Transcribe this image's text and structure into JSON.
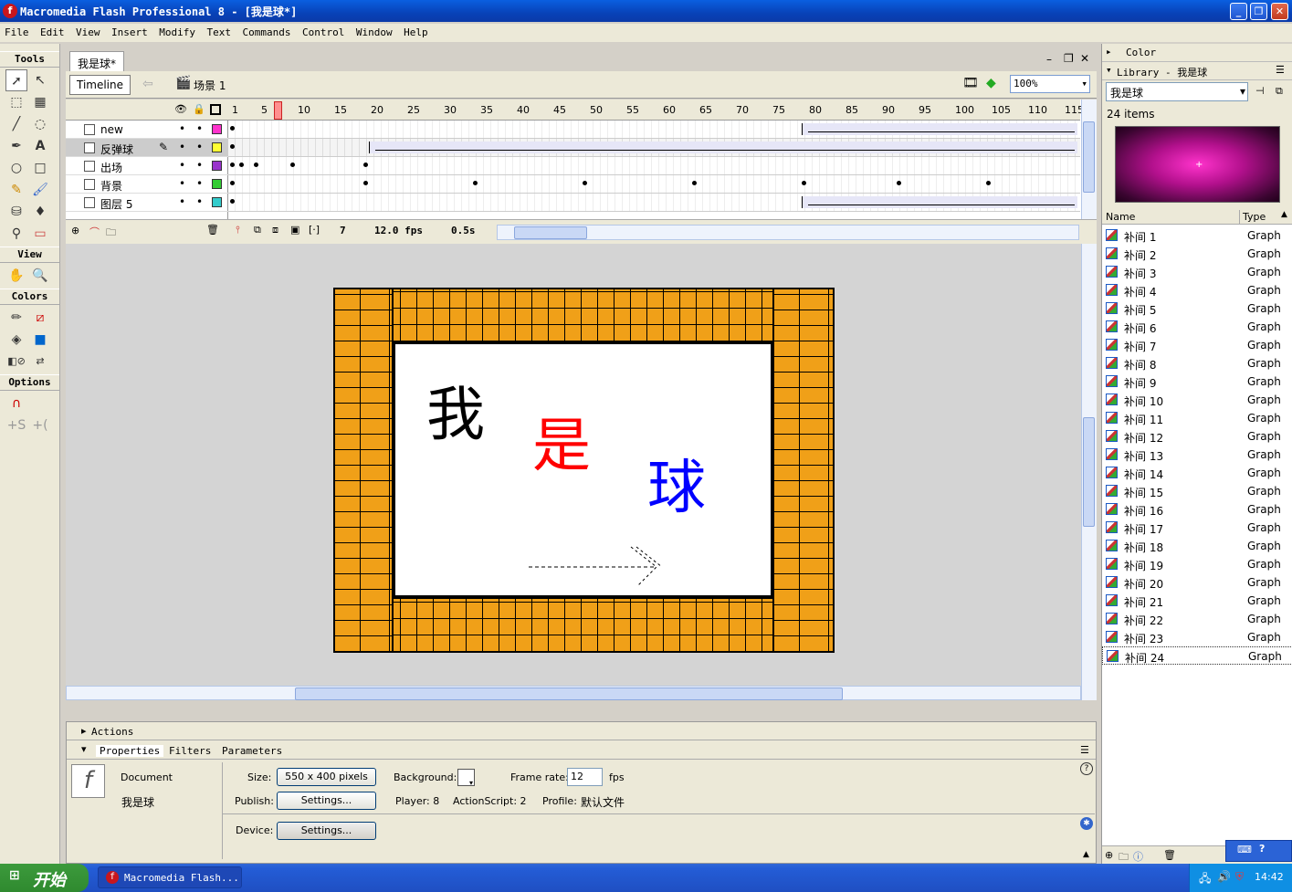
{
  "app": {
    "title": "Macromedia Flash Professional 8 - [我是球*]",
    "icon": "flash-app-icon"
  },
  "menu": [
    "File",
    "Edit",
    "View",
    "Insert",
    "Modify",
    "Text",
    "Commands",
    "Control",
    "Window",
    "Help"
  ],
  "tools": {
    "heading": "Tools",
    "view_heading": "View",
    "colors_heading": "Colors",
    "options_heading": "Options"
  },
  "document": {
    "tab": "我是球*",
    "timeline_button": "Timeline",
    "scene": "场景 1",
    "zoom": "100%"
  },
  "timeline": {
    "frame_numbers": [
      "1",
      "5",
      "10",
      "15",
      "20",
      "25",
      "30",
      "35",
      "40",
      "45",
      "50",
      "55",
      "60",
      "65",
      "70",
      "75",
      "80",
      "85",
      "90",
      "95",
      "100",
      "105",
      "110",
      "115"
    ],
    "current_frame": "7",
    "fps": "12.0 fps",
    "elapsed": "0.5s",
    "layers": [
      {
        "name": "new",
        "color": "#ff33cc",
        "active": false
      },
      {
        "name": "反弹球",
        "color": "#ffff33",
        "active": true
      },
      {
        "name": "出场",
        "color": "#9933cc",
        "active": false
      },
      {
        "name": "背景",
        "color": "#33cc33",
        "active": false
      },
      {
        "name": "图层 5",
        "color": "#33cccc",
        "active": false
      }
    ]
  },
  "stage": {
    "chars": [
      {
        "text": "我",
        "color": "#000000"
      },
      {
        "text": "是",
        "color": "#ff0000"
      },
      {
        "text": "球",
        "color": "#0000ff"
      }
    ],
    "brick_color": "#f0a018"
  },
  "panels": {
    "actions": "Actions",
    "properties_tab": "Properties",
    "filters_tab": "Filters",
    "parameters_tab": "Parameters"
  },
  "properties": {
    "type": "Document",
    "doc_name": "我是球",
    "size_label": "Size:",
    "size_value": "550 x 400 pixels",
    "background_label": "Background:",
    "frame_rate_label": "Frame rate:",
    "frame_rate_value": "12",
    "fps_unit": "fps",
    "publish_label": "Publish:",
    "settings_button": "Settings...",
    "player": "Player: 8",
    "actionscript": "ActionScript: 2",
    "profile_label": "Profile:",
    "profile_value": "默认文件",
    "device_label": "Device:",
    "device_settings": "Settings..."
  },
  "right": {
    "color_panel": "Color",
    "library_panel": "Library - 我是球",
    "library_select": "我是球",
    "item_count": "24 items",
    "col_name": "Name",
    "col_type": "Type",
    "items": [
      {
        "name": "补间 1",
        "type": "Graph"
      },
      {
        "name": "补间 2",
        "type": "Graph"
      },
      {
        "name": "补间 3",
        "type": "Graph"
      },
      {
        "name": "补间 4",
        "type": "Graph"
      },
      {
        "name": "补间 5",
        "type": "Graph"
      },
      {
        "name": "补间 6",
        "type": "Graph"
      },
      {
        "name": "补间 7",
        "type": "Graph"
      },
      {
        "name": "补间 8",
        "type": "Graph"
      },
      {
        "name": "补间 9",
        "type": "Graph"
      },
      {
        "name": "补间 10",
        "type": "Graph"
      },
      {
        "name": "补间 11",
        "type": "Graph"
      },
      {
        "name": "补间 12",
        "type": "Graph"
      },
      {
        "name": "补间 13",
        "type": "Graph"
      },
      {
        "name": "补间 14",
        "type": "Graph"
      },
      {
        "name": "补间 15",
        "type": "Graph"
      },
      {
        "name": "补间 16",
        "type": "Graph"
      },
      {
        "name": "补间 17",
        "type": "Graph"
      },
      {
        "name": "补间 18",
        "type": "Graph"
      },
      {
        "name": "补间 19",
        "type": "Graph"
      },
      {
        "name": "补间 20",
        "type": "Graph"
      },
      {
        "name": "补间 21",
        "type": "Graph"
      },
      {
        "name": "补间 22",
        "type": "Graph"
      },
      {
        "name": "补间 23",
        "type": "Graph"
      },
      {
        "name": "补间 24",
        "type": "Graph"
      }
    ]
  },
  "taskbar": {
    "start": "开始",
    "task": "Macromedia Flash...",
    "clock": "14:42"
  }
}
